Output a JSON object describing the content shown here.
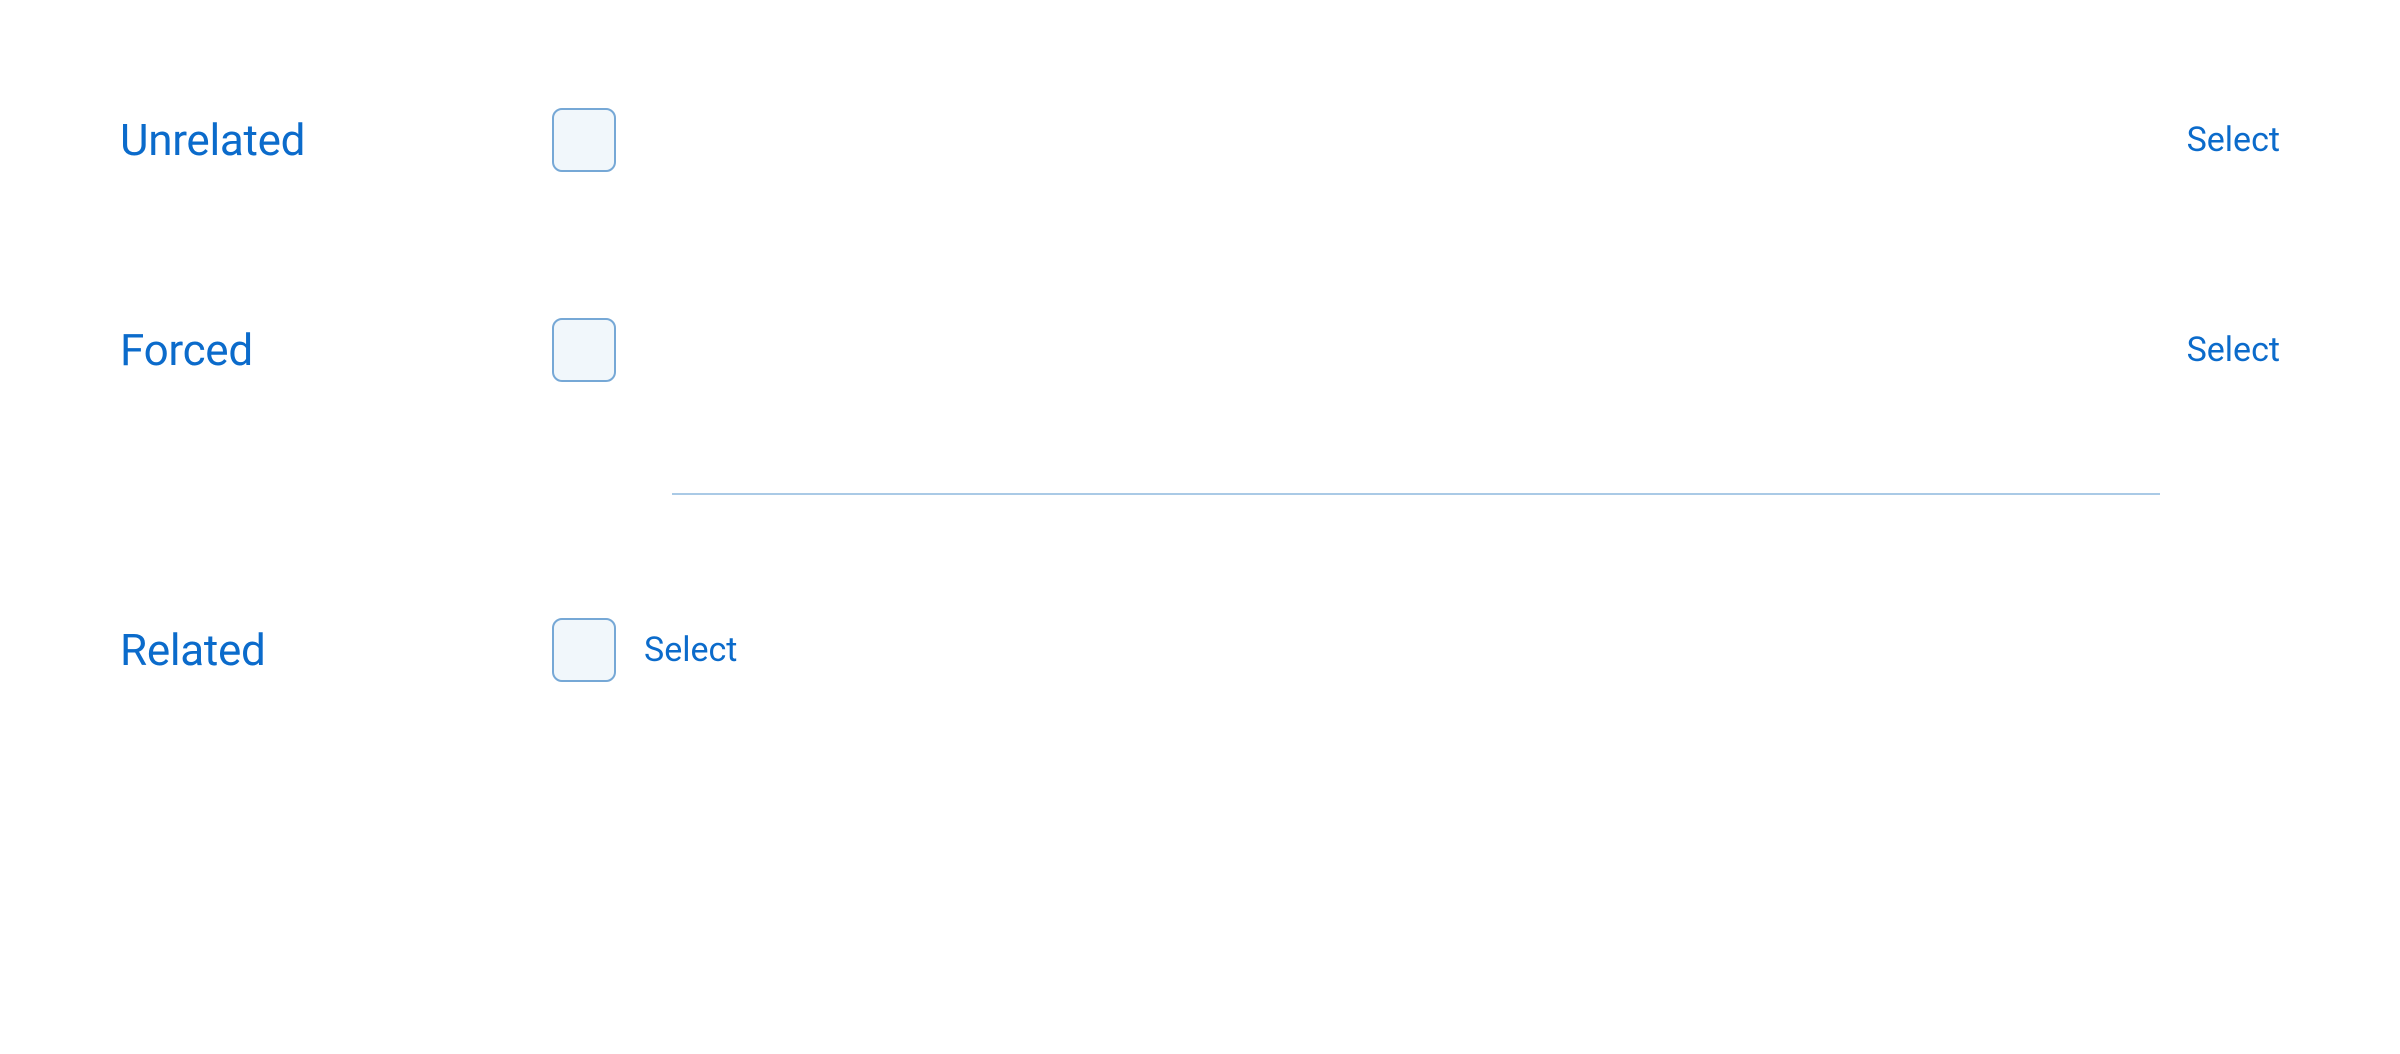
{
  "rows": [
    {
      "label": "Unrelated",
      "action": "Select"
    },
    {
      "label": "Forced",
      "action": "Select"
    },
    {
      "label": "Related",
      "action": "Select"
    }
  ]
}
